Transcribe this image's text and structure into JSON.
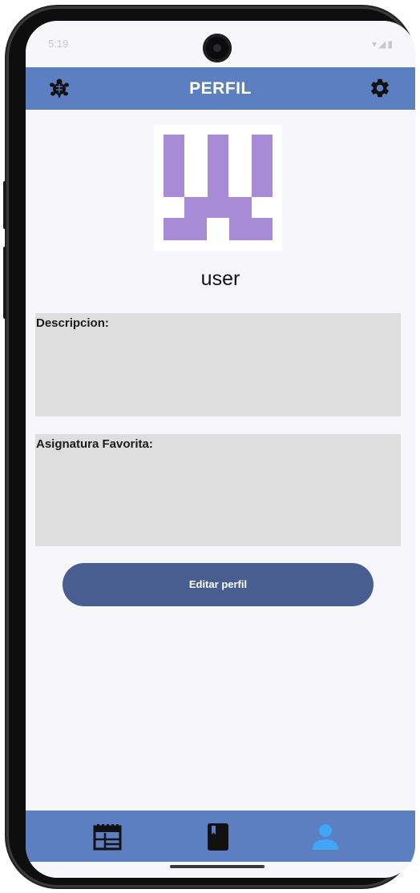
{
  "status_bar": {
    "time": "5:19",
    "right_icons": "▾◢▮"
  },
  "appbar": {
    "title": "PERFIL",
    "left_icon": "turtle-icon",
    "right_icon": "gear-icon",
    "color": "#5b7fc1"
  },
  "profile": {
    "username": "user",
    "avatar_color": "#a78bd6"
  },
  "fields": {
    "description_label": "Descripcion:",
    "favorite_subject_label": "Asignatura Favorita:"
  },
  "edit_button": {
    "label": "Editar perfil",
    "color": "#485d90"
  },
  "bottom_nav": {
    "items": [
      {
        "icon": "calendar-icon",
        "active": false
      },
      {
        "icon": "book-icon",
        "active": false
      },
      {
        "icon": "person-icon",
        "active": true
      }
    ],
    "active_color": "#42a5f5"
  }
}
